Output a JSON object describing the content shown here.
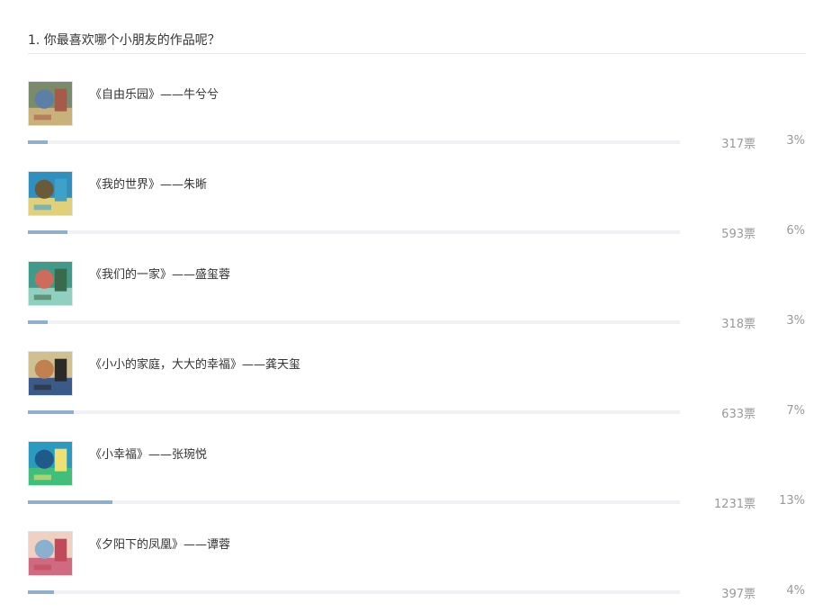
{
  "question": {
    "title": "1. 你最喜欢哪个小朋友的作品呢？"
  },
  "options": [
    {
      "title": "《自由乐园》——牛兮兮",
      "votes": "317票",
      "percent": "3%",
      "fraction": 0.03,
      "thumb_colors": [
        "#7a8a6a",
        "#c9b27a",
        "#5b7fa6",
        "#a85a4a"
      ]
    },
    {
      "title": "《我的世界》——朱晰",
      "votes": "593票",
      "percent": "6%",
      "fraction": 0.06,
      "thumb_colors": [
        "#2f8fbf",
        "#e0d07a",
        "#6b5a3a",
        "#3fa0c8"
      ]
    },
    {
      "title": "《我们的一家》——盛玺蓉",
      "votes": "318票",
      "percent": "3%",
      "fraction": 0.03,
      "thumb_colors": [
        "#3f9a8a",
        "#8fd0c0",
        "#d06a5a",
        "#3a6a4a"
      ]
    },
    {
      "title": "《小小的家庭，大大的幸福》——龚天玺",
      "votes": "633票",
      "percent": "7%",
      "fraction": 0.07,
      "thumb_colors": [
        "#d0c090",
        "#3a5a8a",
        "#c08050",
        "#2a2a2a"
      ]
    },
    {
      "title": "《小幸福》——张琬悦",
      "votes": "1231票",
      "percent": "13%",
      "fraction": 0.13,
      "thumb_colors": [
        "#2a9ac0",
        "#3fbf7a",
        "#1f5a8a",
        "#f0e070"
      ]
    },
    {
      "title": "《夕阳下的凤凰》——谭蓉",
      "votes": "397票",
      "percent": "4%",
      "fraction": 0.04,
      "thumb_colors": [
        "#f0d0c0",
        "#d06a80",
        "#8ab0d0",
        "#c04a5a"
      ]
    }
  ],
  "colors": {
    "bar_fill": "#8fb0cc",
    "bar_track": "#f1f1f5",
    "muted_text": "#999999"
  }
}
